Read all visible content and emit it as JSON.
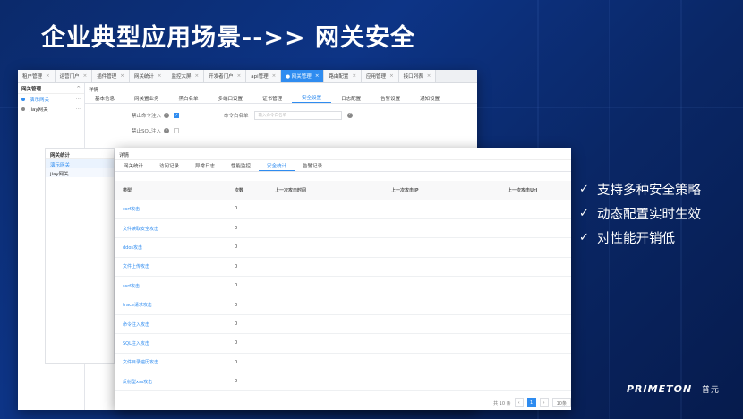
{
  "slide": {
    "title": "企业典型应用场景-->> 网关安全",
    "features": [
      "支持多种安全策略",
      "动态配置实时生效",
      "对性能开销低"
    ],
    "logo_text": "PRIMETON",
    "logo_cn": "· 普元"
  },
  "colors": {
    "accent": "#2f8cf0",
    "background": "#0d3486"
  },
  "win1": {
    "tabs": [
      {
        "label": "租户管理",
        "active": false
      },
      {
        "label": "运营门户",
        "active": false
      },
      {
        "label": "插件管理",
        "active": false
      },
      {
        "label": "网关统计",
        "active": false
      },
      {
        "label": "监控大屏",
        "active": false
      },
      {
        "label": "开发者门户",
        "active": false
      },
      {
        "label": "api管理",
        "active": false
      },
      {
        "label": "● 网关管理",
        "active": true
      },
      {
        "label": "路由配置",
        "active": false
      },
      {
        "label": "应用管理",
        "active": false
      },
      {
        "label": "接口列表",
        "active": false
      }
    ],
    "sidebar": {
      "header": "网关管理",
      "header_icon": "^",
      "items": [
        {
          "label": "演示网关",
          "selected": true
        },
        {
          "label": "jiay网关",
          "selected": false
        }
      ]
    },
    "crumb": "详情",
    "subtabs": [
      "基本信息",
      "网关置业务",
      "黑白名单",
      "多端口设置",
      "证书管理",
      "安全设置",
      "日志配置",
      "告警设置",
      "通知设置"
    ],
    "active_subtab": "安全设置",
    "form": {
      "cmd_injection_label": "禁止命令注入",
      "cmd_whitelist_label": "命令白名单",
      "cmd_whitelist_placeholder": "输入命令白名单",
      "sql_injection_label": "禁止SQL注入"
    }
  },
  "popup": {
    "header": "网关统计",
    "items": [
      "演示网关",
      "jiay网关"
    ]
  },
  "win2": {
    "crumb": "详情",
    "subtabs": [
      "网关统计",
      "访问记录",
      "异常日志",
      "性能监控",
      "安全统计",
      "告警记录"
    ],
    "active_subtab": "安全统计",
    "columns": [
      "类型",
      "次数",
      "上一次攻击时间",
      "上一次攻击IP",
      "上一次攻击Url"
    ],
    "rows": [
      {
        "type": "csrf攻击",
        "count": "0"
      },
      {
        "type": "文件读取安全攻击",
        "count": "0"
      },
      {
        "type": "ddos攻击",
        "count": "0"
      },
      {
        "type": "文件上传攻击",
        "count": "0"
      },
      {
        "type": "ssrf攻击",
        "count": "0"
      },
      {
        "type": "trace请求攻击",
        "count": "0"
      },
      {
        "type": "命令注入攻击",
        "count": "0"
      },
      {
        "type": "SQL注入攻击",
        "count": "0"
      },
      {
        "type": "文件目录遍历攻击",
        "count": "0"
      },
      {
        "type": "反射型xss攻击",
        "count": "0"
      }
    ],
    "pager": {
      "total": "共 10 条",
      "prev": "‹",
      "page": "1",
      "next": "›",
      "size": "10条"
    }
  }
}
